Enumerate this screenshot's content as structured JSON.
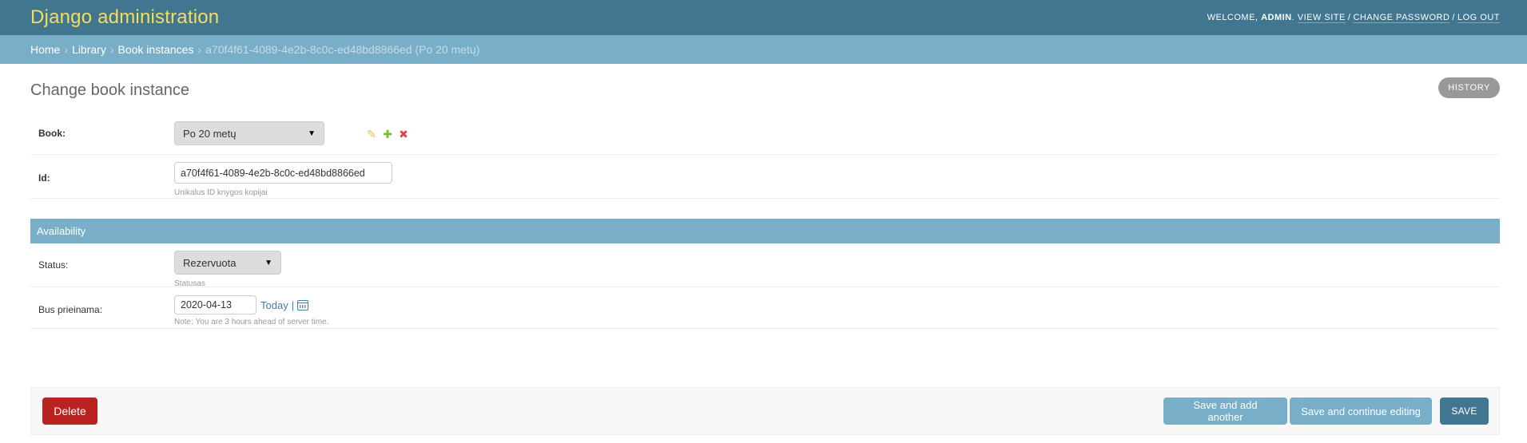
{
  "header": {
    "brand": "Django administration",
    "welcome": "Welcome,",
    "username": "admin",
    "links": [
      "View site",
      "Change password",
      "Log out"
    ],
    "sep": "/"
  },
  "breadcrumbs": {
    "items": [
      "Home",
      "Library",
      "Book instances"
    ],
    "current": "a70f4f61-4089-4e2b-8c0c-ed48bd8866ed (Po 20 metų)",
    "arrow": "›"
  },
  "page": {
    "title": "Change book instance",
    "history_label": "History"
  },
  "form": {
    "book": {
      "label": "Book:",
      "value": "Po 20 metų"
    },
    "id": {
      "label": "Id:",
      "value": "a70f4f61-4089-4e2b-8c0c-ed48bd8866ed",
      "help": "Unikalus ID knygos kopijai"
    },
    "availability": {
      "header": "Availability",
      "status": {
        "label": "Status:",
        "value": "Rezervuota",
        "help": "Statusas"
      },
      "due": {
        "label": "Bus prieinama:",
        "value": "2020-04-13",
        "today": "Today",
        "pipe": "|",
        "note": "Note: You are 3 hours ahead of server time."
      }
    }
  },
  "actions": {
    "delete": "Delete",
    "save_add": "Save and add another",
    "save_continue": "Save and continue editing",
    "save": "Save"
  },
  "colors": {
    "header_bg": "#417690",
    "brand": "#f5dd5d",
    "breadcrumbs_bg": "#79aec8",
    "delete": "#ba2121"
  }
}
